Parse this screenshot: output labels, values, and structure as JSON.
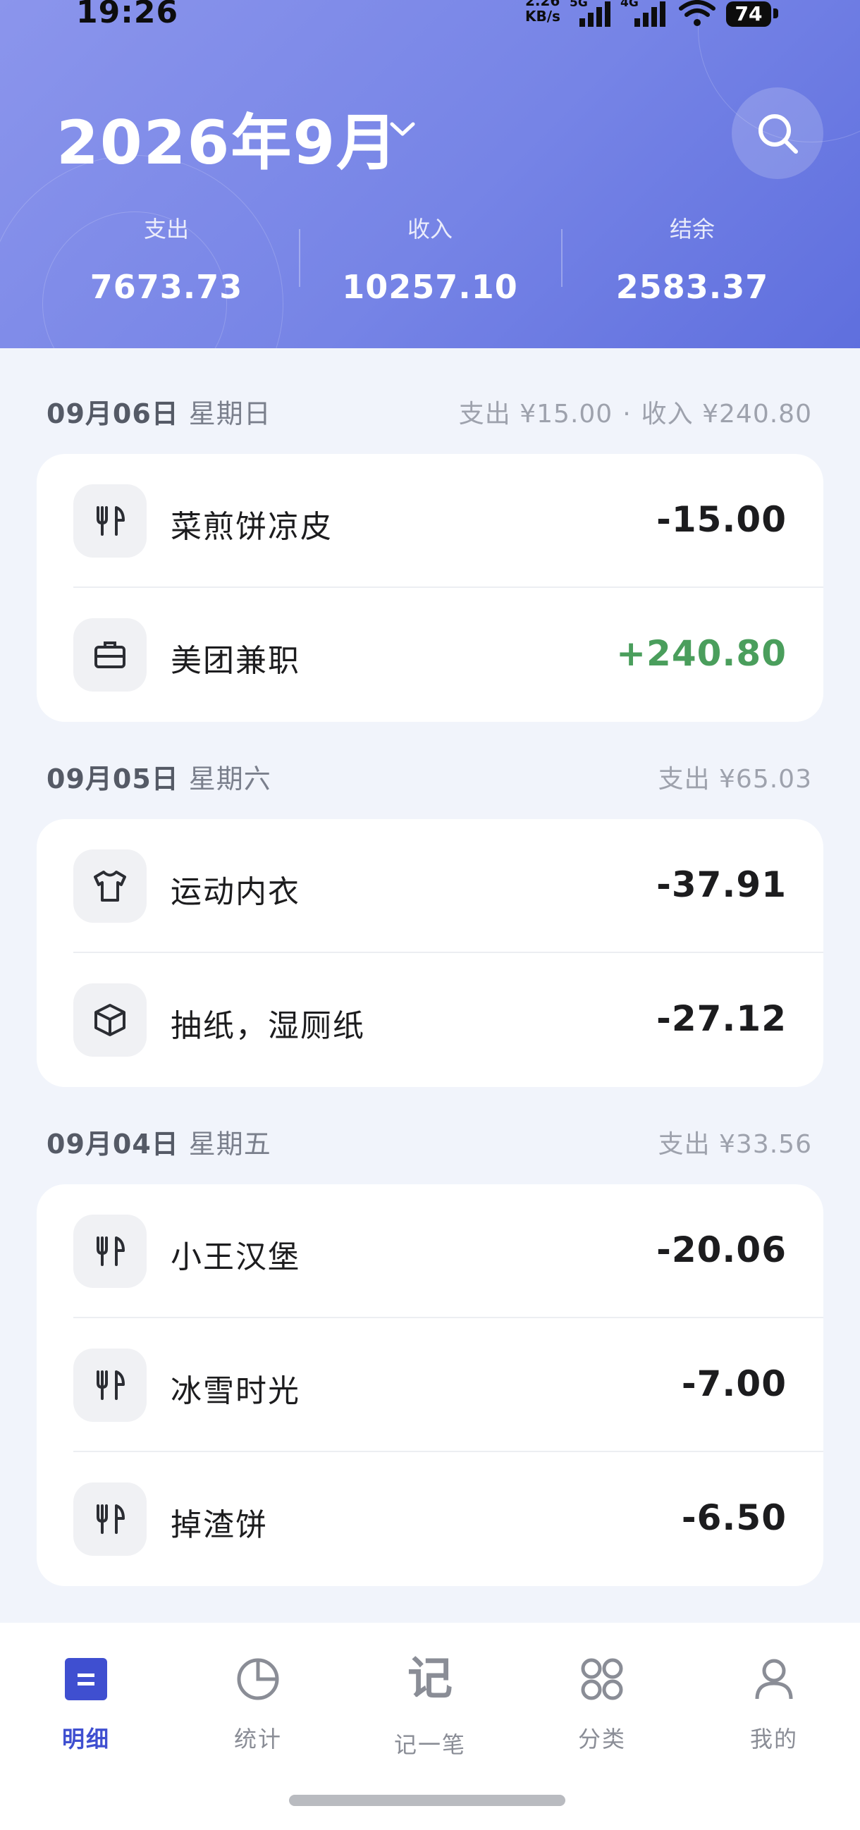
{
  "status_bar": {
    "time": "19:26",
    "net_speed_value": "2.26",
    "net_speed_unit": "KB/s",
    "net_5g": "5G",
    "net_4g": "4G",
    "battery": "74"
  },
  "header": {
    "month_title": "2026年9月",
    "search_icon": "search-icon",
    "chevron_icon": "chevron-down-icon"
  },
  "summary": {
    "expense_label": "支出",
    "expense_value": "7673.73",
    "income_label": "收入",
    "income_value": "10257.10",
    "balance_label": "结余",
    "balance_value": "2583.37"
  },
  "days": [
    {
      "date": "09月06日",
      "weekday": "星期日",
      "expense_total": "支出 ¥15.00",
      "separator": "·",
      "income_total": "收入 ¥240.80",
      "items": [
        {
          "icon": "fork-knife-icon",
          "name": "菜煎饼凉皮",
          "amount": "-15.00"
        },
        {
          "icon": "briefcase-icon",
          "name": "美团兼职",
          "amount": "+240.80"
        }
      ]
    },
    {
      "date": "09月05日",
      "weekday": "星期六",
      "expense_total": "支出 ¥65.03",
      "items": [
        {
          "icon": "shirt-icon",
          "name": "运动内衣",
          "amount": "-37.91"
        },
        {
          "icon": "box-icon",
          "name": "抽纸，湿厕纸",
          "amount": "-27.12"
        }
      ]
    },
    {
      "date": "09月04日",
      "weekday": "星期五",
      "expense_total": "支出 ¥33.56",
      "items": [
        {
          "icon": "fork-knife-icon",
          "name": "小王汉堡",
          "amount": "-20.06"
        },
        {
          "icon": "fork-knife-icon",
          "name": "冰雪时光",
          "amount": "-7.00"
        },
        {
          "icon": "fork-knife-icon",
          "name": "掉渣饼",
          "amount": "-6.50"
        }
      ]
    }
  ],
  "tabs": [
    {
      "label": "明细",
      "icon": "list-icon",
      "active": true
    },
    {
      "label": "统计",
      "icon": "pie-chart-icon"
    },
    {
      "label": "记一笔",
      "icon": "record-icon",
      "icon_text": "记"
    },
    {
      "label": "分类",
      "icon": "grid-icon"
    },
    {
      "label": "我的",
      "icon": "person-icon"
    }
  ],
  "colors": {
    "header_start": "#8b95ec",
    "header_end": "#5f6fde",
    "income_green": "#4a9e5c",
    "active_tab": "#3f4fd0"
  }
}
